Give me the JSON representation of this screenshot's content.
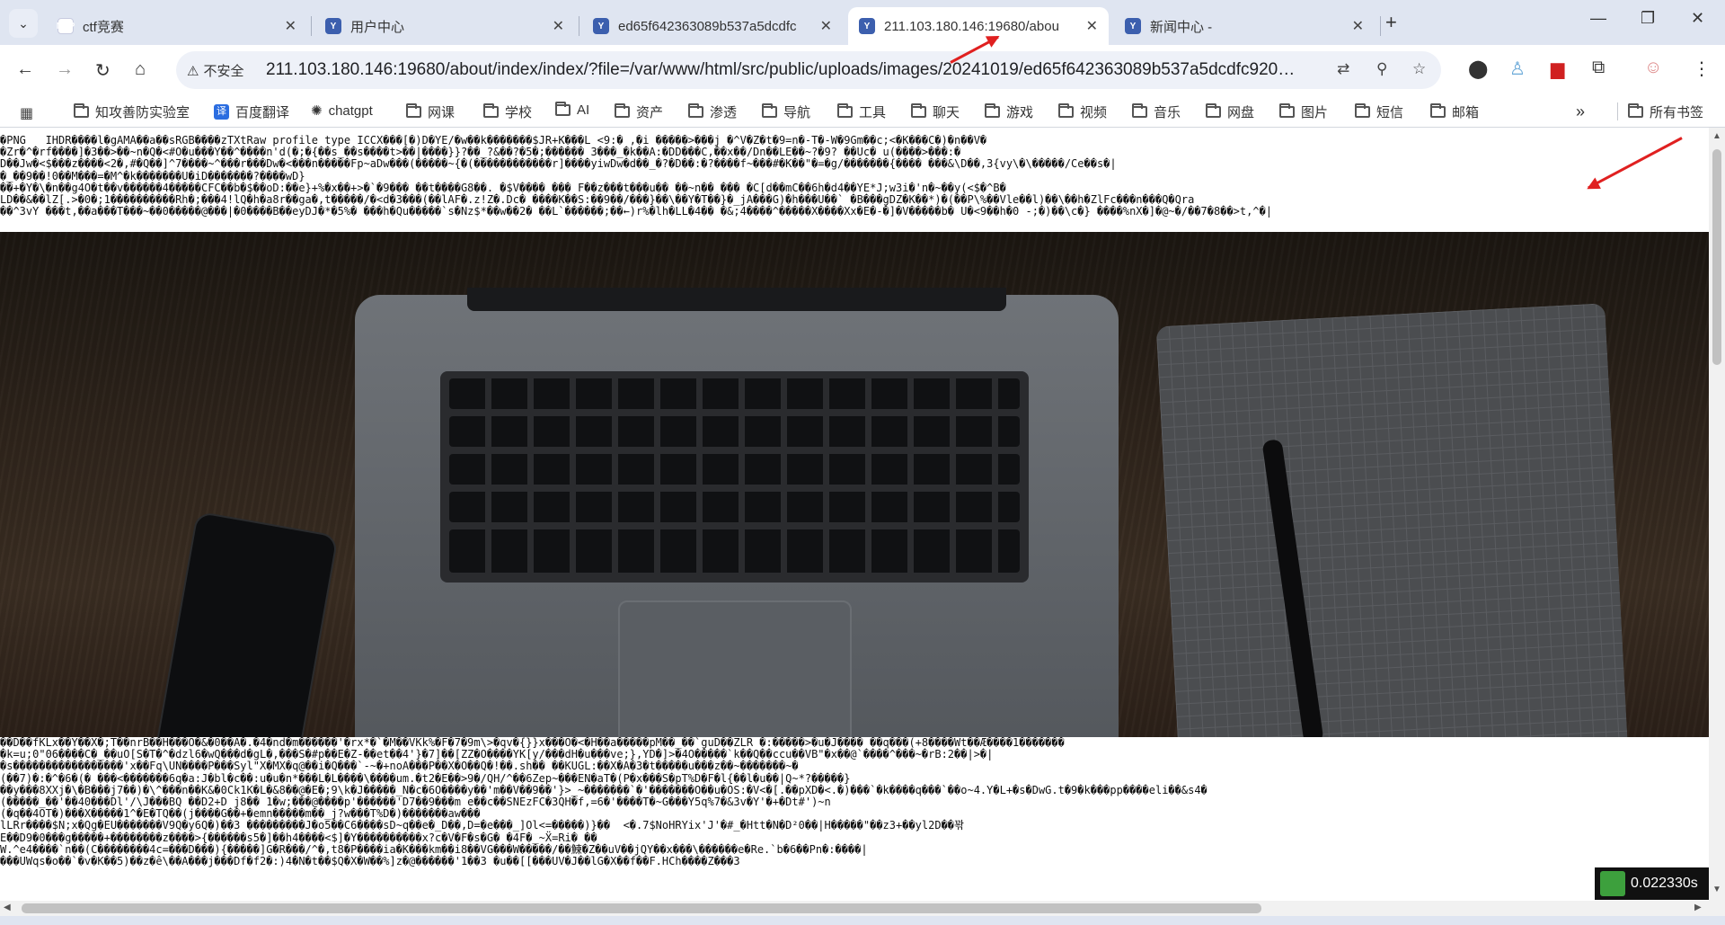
{
  "tabs": [
    {
      "title": "ctf竞赛",
      "favicon": "ctf-logo-icon",
      "active": false
    },
    {
      "title": "用户中心",
      "favicon": "y-logo-icon",
      "active": false
    },
    {
      "title": "ed65f642363089b537a5dcdfc",
      "favicon": "y-logo-icon",
      "active": false
    },
    {
      "title": "211.103.180.146:19680/abou",
      "favicon": "y-logo-icon",
      "active": true
    },
    {
      "title": "新闻中心 -",
      "favicon": "y-logo-icon",
      "active": false
    }
  ],
  "toolbar": {
    "security_label": "不安全",
    "url": "211.103.180.146:19680/about/index/index/?file=/var/www/html/src/public/uploads/images/20241019/ed65f642363089b537a5dcdfc92032..."
  },
  "bookmarks": [
    {
      "label": "知攻善防实验室",
      "icon": "folder-icon"
    },
    {
      "label": "百度翻译",
      "icon": "translate-icon"
    },
    {
      "label": "chatgpt",
      "icon": "openai-icon"
    },
    {
      "label": "网课",
      "icon": "folder-icon"
    },
    {
      "label": "学校",
      "icon": "folder-icon"
    },
    {
      "label": "AI",
      "icon": "folder-icon"
    },
    {
      "label": "资产",
      "icon": "folder-icon"
    },
    {
      "label": "渗透",
      "icon": "folder-icon"
    },
    {
      "label": "导航",
      "icon": "folder-icon"
    },
    {
      "label": "工具",
      "icon": "folder-icon"
    },
    {
      "label": "聊天",
      "icon": "folder-icon"
    },
    {
      "label": "游戏",
      "icon": "folder-icon"
    },
    {
      "label": "视频",
      "icon": "folder-icon"
    },
    {
      "label": "音乐",
      "icon": "folder-icon"
    },
    {
      "label": "网盘",
      "icon": "folder-icon"
    },
    {
      "label": "图片",
      "icon": "folder-icon"
    },
    {
      "label": "短信",
      "icon": "folder-icon"
    },
    {
      "label": "邮箱",
      "icon": "folder-icon"
    }
  ],
  "bookmarks_more": "»",
  "all_bookmarks": "所有书签",
  "page": {
    "binary_top": "�PNG   IHDR����l�gAMA��a��sRGB����zTXtRaw profile type ICCX���[�)D�YE/�w��k�������$JR+K���L <9:� ,�i �����>���j �^V�Z�t�9=n�-T�-W�9Gm��c;<�K���C�)�n��V�\n�Zr�^�rf����]�3��>��~n�Q�<#O�u���Y��^����n'd(�;�{��s_��s����t>��|����}}?��_?&��?�5�;������ 3���_�k��A:�DD���C,��x��/Dn��LE��~?�9? ��Uc� u(����>���:�\nD��Jw�<$���z����<2�,#�Q��]^7����~^���r���Dw�<���n�����Fp~aDw���(�����~{�(������������r]����yiwDw�d��_�?�D��:�?����f~���#�K��\"�=�g/�������{���� ���&\\D��,3{vy\\�\\�����/Ce��s�|\n�_��9��!0��M���=�M^�k�������U�iD�������?����wD}\n��+�Y�\\�n��g4O�t��v������4�����CFC��b�$��oD:��e}+%�x��+>�`�9��� ��t����G8��. �$V���� ��� F��z���t���u�� ��~n�� ��� �C[d��mC��6h�d4��YE*J;w3i�'n�~��y(<$�^B�\nLD��&��lZ[.>�0�;1����������Rh�;���4!lQ�h�a8r��ga�,t�����/�<d�3���(��lAF�.z!Z�.Dc� ����K��S:��9��/���}��\\��Y�T��}�_jA���G)�h���U��` �B���gDZ�K��*)�(��P\\%��Vle��l)��\\��h�ZlFc���n���Q�Qra\n��^3vY ���t,��a���T���~��0�����@���|�0����B��eyDJ�*�5%� ���h�Qu�����`s�Nz$*��w��2� ��L`������;��←)r%�lh�LL�4�� �&;4����^�����X����Xx�E�-�]�V�����b� U�<9��h�0 -;�)��\\c�} ����%nX�]�@~�/��7�8��>t,^�|",
    "binary_bottom": "��D��fKLx��Y��X�;T��nrB��H���O�&�0��A�.�4�nd�m������'�rx*�`�M��VKk%�F�7�9m\\>�qv�{}}x���O�<�H��a�����pM��_��`guD��ZLR �:�����>�u�J���� ��q���(+8����Wt��Æ����1�������\n�k=u;0\"06����C�_��uO[S�T�^�dzl6�wQ���d�gL�,���S�#p��E�Z-��et��4'}�7]��[ZZ�O����YK[y/���dH�u���ve;},YD�]>�4O�����`k��Q��ccu��VB\"�x��@`����^���~�rB:2��|>�|\n�s�����������������'x��Fq\\UN����P���Syl\"X�MX�q@��i�Q���`-~�+noA���P��X�O��Q�!��.sh�� ��KUGL:��X�A�3�t�����u���z��~�������~�\n(��7)�:�^�6�(� ���<�������6q�a:J�bl�c��:u�u�n*���L�L����\\����um.�t2�E��>9�/QH/^��6Zep~���EN�aT�(P�x���S�pT%D�F�l{��l�u��|Q~*?�����}\n��y���8XXj�\\�B���j7��)�\\^���n��K&�0Ck1K�L�&8��@�E�;9\\k�J�����_N�c�6O����y��'m��V��9��'}>_~�������`�'�������O��u�OS:�V<�[.��pXD�<.�)���`�k����q���`��o~4.Y�L+�s�DwG.t�9�k���pp����eli��&s4�\n(�����_��'��40���Dl'/\\J���BQ ��D2+D j8�� 1�w;���@����p'������'D7��9���m e��c��SNEzFC�3QH�f,=6�'����T�~G���Y5q%7�&3v�Y'�+�Dt#')~n\n(�q��4OT�)���X�����1^�E�TQ��(j����G��+�emn�����m��_j?w���T%D�)�������aw���\nlLRr����$N;x�Qg�EU�������V9Q�y6Q�)��3 ���������J�o5��C6����sD~q��e�_D��,D=�e���_]Ol<=�����)}��  <�.7$NoHRYix'J'�#_�Htt�N�D²0��|H�����\"��z3+��yl2D��꽊\nE��D9�0���g�����+��������z����>{������s5�]��h4����<$]�Y����������x?c�V�F�s�G� �4F�_~Ẍ=Ri� ��\nW.^e4����`n��(C��������4c=���D���){�����]G�R���/^�,t8�P����ia�K���km��i8��VG���W�����/��鰊�Z��uV��jQY��x���\\������e�Re.`b�6��Pn�:����|\n���UWqs�o��`�v�K��5)��z�ê\\��A���j���Df�f2�:)4�N�t��$Q�X�W��%]z�@������'1��3 �u��[[���UV�J��lG�X��f��F.HCh����Z���3"
  },
  "timer": "0.022330s",
  "arrow_color": "#e02020"
}
